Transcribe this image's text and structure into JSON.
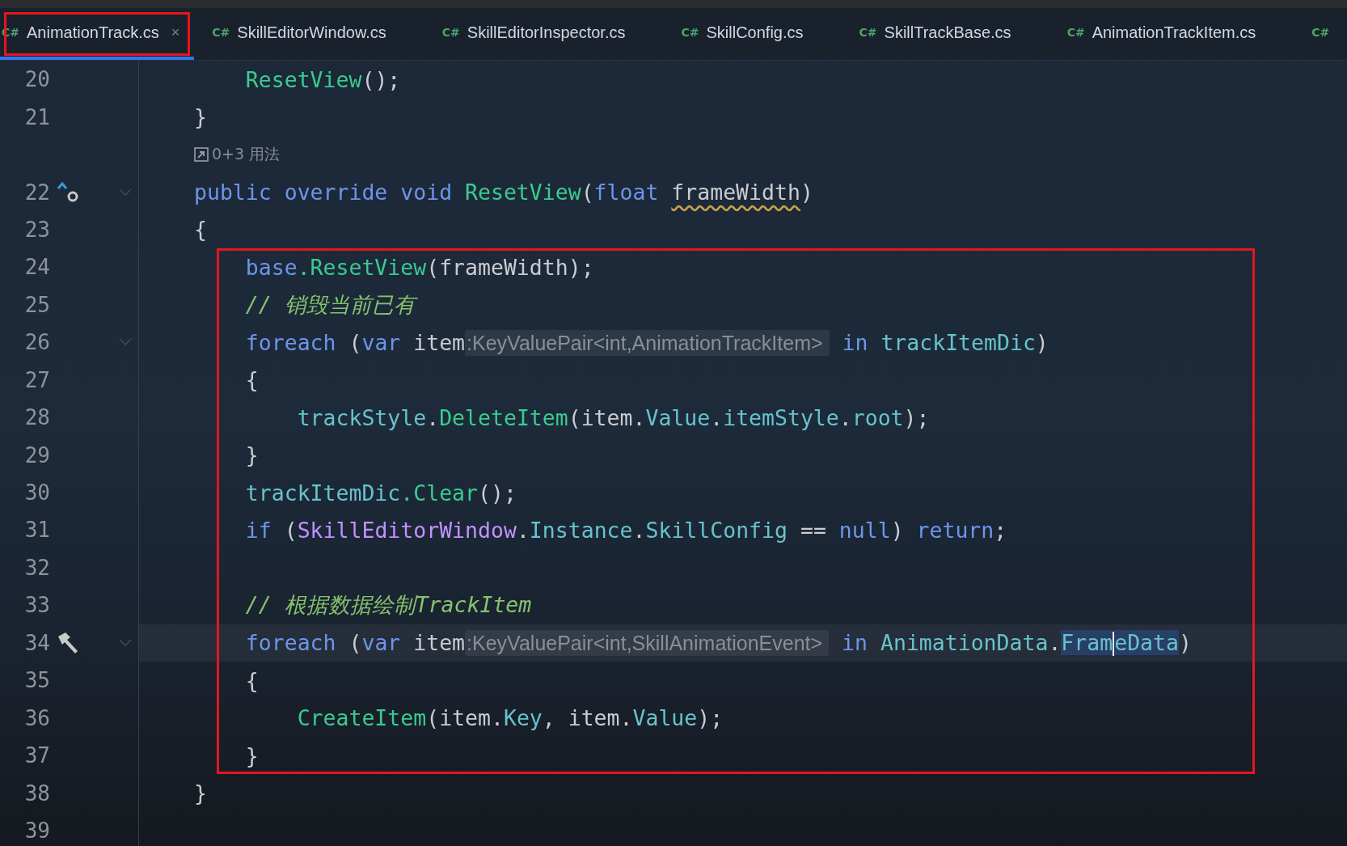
{
  "tabs": [
    {
      "icon_text": "C#",
      "label": "AnimationTrack.cs",
      "selected": true,
      "annotated": true,
      "close": "×"
    },
    {
      "icon_text": "C#",
      "label": "SkillEditorWindow.cs",
      "selected": false,
      "annotated": false
    },
    {
      "icon_text": "C#",
      "label": "SkillEditorInspector.cs",
      "selected": false,
      "annotated": false
    },
    {
      "icon_text": "C#",
      "label": "SkillConfig.cs",
      "selected": false,
      "annotated": false
    },
    {
      "icon_text": "C#",
      "label": "SkillTrackBase.cs",
      "selected": false,
      "annotated": false
    },
    {
      "icon_text": "C#",
      "label": "AnimationTrackItem.cs",
      "selected": false,
      "annotated": false
    },
    {
      "icon_text": "C#",
      "selected": false,
      "annotated": false
    }
  ],
  "lines": [
    {
      "kind": "code",
      "number": "20",
      "boxed": false,
      "tokens": [
        {
          "kind": "fn",
          "text": "    ResetView"
        },
        {
          "kind": "txt",
          "text": "();"
        }
      ]
    },
    {
      "kind": "code",
      "number": "21",
      "boxed": false,
      "tokens": [
        {
          "kind": "txt",
          "text": "}"
        }
      ]
    },
    {
      "kind": "usages",
      "text": "0+3 用法"
    },
    {
      "kind": "code",
      "number": "22",
      "marker": {
        "kind": "override"
      },
      "foldable": true,
      "boxed": false,
      "tokens": [
        {
          "kind": "kw",
          "text": "public override void "
        },
        {
          "kind": "fn",
          "text": "ResetView"
        },
        {
          "kind": "txt",
          "text": "("
        },
        {
          "kind": "kw",
          "text": "float "
        },
        {
          "kind": "param",
          "text": "frameWidth"
        },
        {
          "kind": "txt",
          "text": ")"
        }
      ]
    },
    {
      "kind": "code",
      "number": "23",
      "boxed": false,
      "tokens": [
        {
          "kind": "txt",
          "text": "{"
        }
      ]
    },
    {
      "kind": "code",
      "number": "24",
      "boxed": true,
      "tokens": [
        {
          "kind": "kw",
          "text": "    base"
        },
        {
          "kind": "fn",
          "text": ".ResetView"
        },
        {
          "kind": "txt",
          "text": "(frameWidth);"
        }
      ]
    },
    {
      "kind": "code",
      "number": "25",
      "boxed": true,
      "tokens": [
        {
          "kind": "comment",
          "text": "    // 销毁当前已有"
        }
      ]
    },
    {
      "kind": "code",
      "number": "26",
      "foldable": true,
      "boxed": true,
      "tokens": [
        {
          "kind": "kw",
          "text": "    foreach"
        },
        {
          "kind": "txt",
          "text": " ("
        },
        {
          "kind": "kw",
          "text": "var"
        },
        {
          "kind": "txt",
          "text": " item"
        },
        {
          "kind": "hint",
          "text": ":KeyValuePair<int,AnimationTrackItem>"
        },
        {
          "kind": "kw",
          "text": " in "
        },
        {
          "kind": "field",
          "text": "trackItemDic"
        },
        {
          "kind": "txt",
          "text": ")"
        }
      ]
    },
    {
      "kind": "code",
      "number": "27",
      "boxed": true,
      "tokens": [
        {
          "kind": "txt",
          "text": "    {"
        }
      ]
    },
    {
      "kind": "code",
      "number": "28",
      "boxed": true,
      "tokens": [
        {
          "kind": "field",
          "text": "        trackStyle"
        },
        {
          "kind": "txt",
          "text": "."
        },
        {
          "kind": "fn",
          "text": "DeleteItem"
        },
        {
          "kind": "txt",
          "text": "(item."
        },
        {
          "kind": "field",
          "text": "Value"
        },
        {
          "kind": "txt",
          "text": "."
        },
        {
          "kind": "field",
          "text": "itemStyle"
        },
        {
          "kind": "txt",
          "text": "."
        },
        {
          "kind": "field",
          "text": "root"
        },
        {
          "kind": "txt",
          "text": ");"
        }
      ]
    },
    {
      "kind": "code",
      "number": "29",
      "boxed": true,
      "tokens": [
        {
          "kind": "txt",
          "text": "    }"
        }
      ]
    },
    {
      "kind": "code",
      "number": "30",
      "boxed": true,
      "tokens": [
        {
          "kind": "field",
          "text": "    trackItemDic"
        },
        {
          "kind": "fn",
          "text": ".Clear"
        },
        {
          "kind": "txt",
          "text": "();"
        }
      ]
    },
    {
      "kind": "code",
      "number": "31",
      "boxed": true,
      "tokens": [
        {
          "kind": "kw",
          "text": "    if"
        },
        {
          "kind": "txt",
          "text": " ("
        },
        {
          "kind": "type",
          "text": "SkillEditorWindow"
        },
        {
          "kind": "txt",
          "text": "."
        },
        {
          "kind": "field",
          "text": "Instance"
        },
        {
          "kind": "txt",
          "text": "."
        },
        {
          "kind": "field",
          "text": "SkillConfig"
        },
        {
          "kind": "txt",
          "text": " == "
        },
        {
          "kind": "kw",
          "text": "null"
        },
        {
          "kind": "txt",
          "text": ") "
        },
        {
          "kind": "kw",
          "text": "return"
        },
        {
          "kind": "txt",
          "text": ";"
        }
      ]
    },
    {
      "kind": "code",
      "number": "32",
      "boxed": true
    },
    {
      "kind": "code",
      "number": "33",
      "boxed": true,
      "tokens": [
        {
          "kind": "comment",
          "text": "    // 根据数据绘制TrackItem"
        }
      ]
    },
    {
      "kind": "code",
      "number": "34",
      "marker": {
        "kind": "hammer"
      },
      "foldable": true,
      "current": true,
      "boxed": true,
      "tokens": [
        {
          "kind": "kw",
          "text": "    foreach"
        },
        {
          "kind": "txt",
          "text": " ("
        },
        {
          "kind": "kw",
          "text": "var"
        },
        {
          "kind": "txt",
          "text": " item"
        },
        {
          "kind": "hint",
          "text": ":KeyValuePair<int,SkillAnimationEvent>"
        },
        {
          "kind": "kw",
          "text": " in "
        },
        {
          "kind": "field",
          "text": "AnimationData"
        },
        {
          "kind": "txt",
          "text": "."
        },
        {
          "kind": "sel",
          "text": "Fram"
        },
        {
          "kind": "caret"
        },
        {
          "kind": "sel",
          "text": "eData"
        },
        {
          "kind": "txt",
          "text": ")"
        }
      ]
    },
    {
      "kind": "code",
      "number": "35",
      "boxed": true,
      "tokens": [
        {
          "kind": "txt",
          "text": "    {"
        }
      ]
    },
    {
      "kind": "code",
      "number": "36",
      "boxed": true,
      "tokens": [
        {
          "kind": "fn",
          "text": "        CreateItem"
        },
        {
          "kind": "txt",
          "text": "(item."
        },
        {
          "kind": "field",
          "text": "Key"
        },
        {
          "kind": "txt",
          "text": ", item."
        },
        {
          "kind": "field",
          "text": "Value"
        },
        {
          "kind": "txt",
          "text": ");"
        }
      ]
    },
    {
      "kind": "code",
      "number": "37",
      "boxed": true,
      "tokens": [
        {
          "kind": "txt",
          "text": "    }"
        }
      ]
    },
    {
      "kind": "code",
      "number": "38",
      "boxed": false,
      "tokens": [
        {
          "kind": "txt",
          "text": "}"
        }
      ]
    },
    {
      "kind": "code",
      "number": "39",
      "boxed": false
    }
  ]
}
